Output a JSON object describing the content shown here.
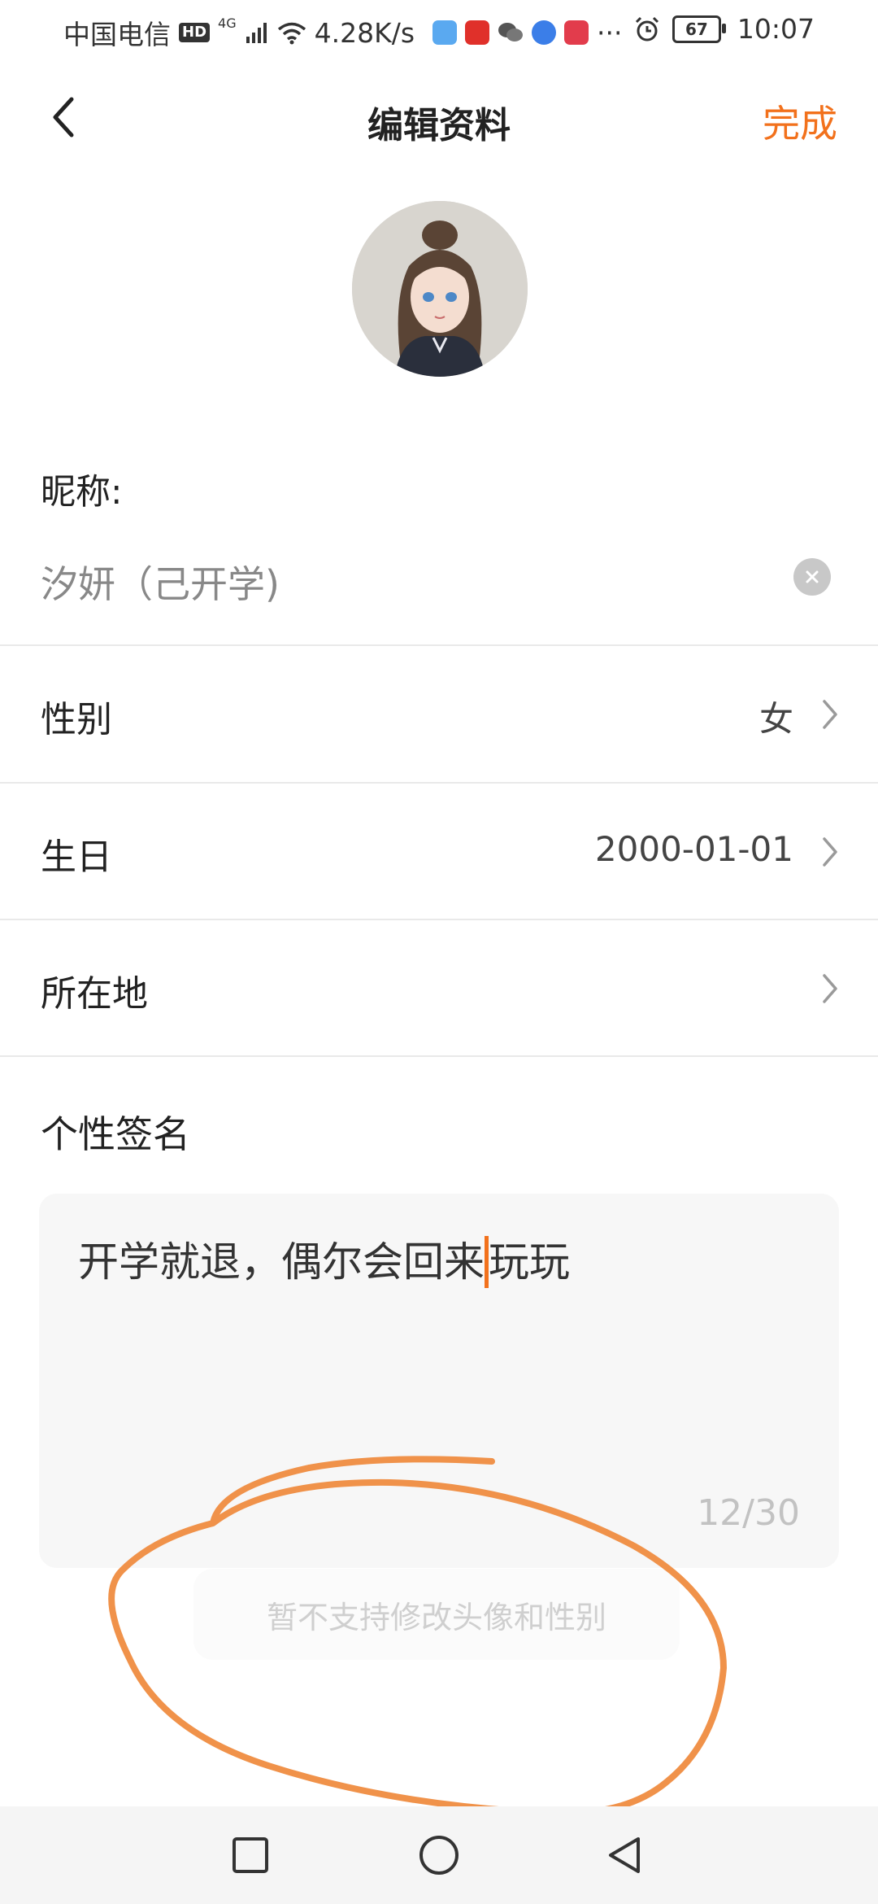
{
  "status_bar": {
    "carrier": "中国电信",
    "hd": "HD",
    "network": "4G",
    "speed": "4.28K/s",
    "more": "···",
    "battery": "67",
    "time": "10:07",
    "icons": [
      "signal-icon",
      "wifi-icon",
      "app-icon",
      "app-icon",
      "wechat-icon",
      "app-icon",
      "book-icon",
      "alarm-icon",
      "battery-icon"
    ]
  },
  "header": {
    "title": "编辑资料",
    "done_label": "完成",
    "back_icon": "chevron-left-icon"
  },
  "profile": {
    "nickname_label": "昵称:",
    "nickname_value": "汐妍（己开学)"
  },
  "rows": [
    {
      "label": "性别",
      "value": "女"
    },
    {
      "label": "生日",
      "value": "2000-01-01"
    },
    {
      "label": "所在地",
      "value": ""
    }
  ],
  "signature": {
    "label": "个性签名",
    "text_before_cursor": "开学就退，偶尔会回来",
    "text_after_cursor": "玩玩",
    "counter": "12/30"
  },
  "toast": {
    "message": "暂不支持修改头像和性别"
  },
  "colors": {
    "accent": "#f2711c",
    "annotation": "#f0924a"
  }
}
